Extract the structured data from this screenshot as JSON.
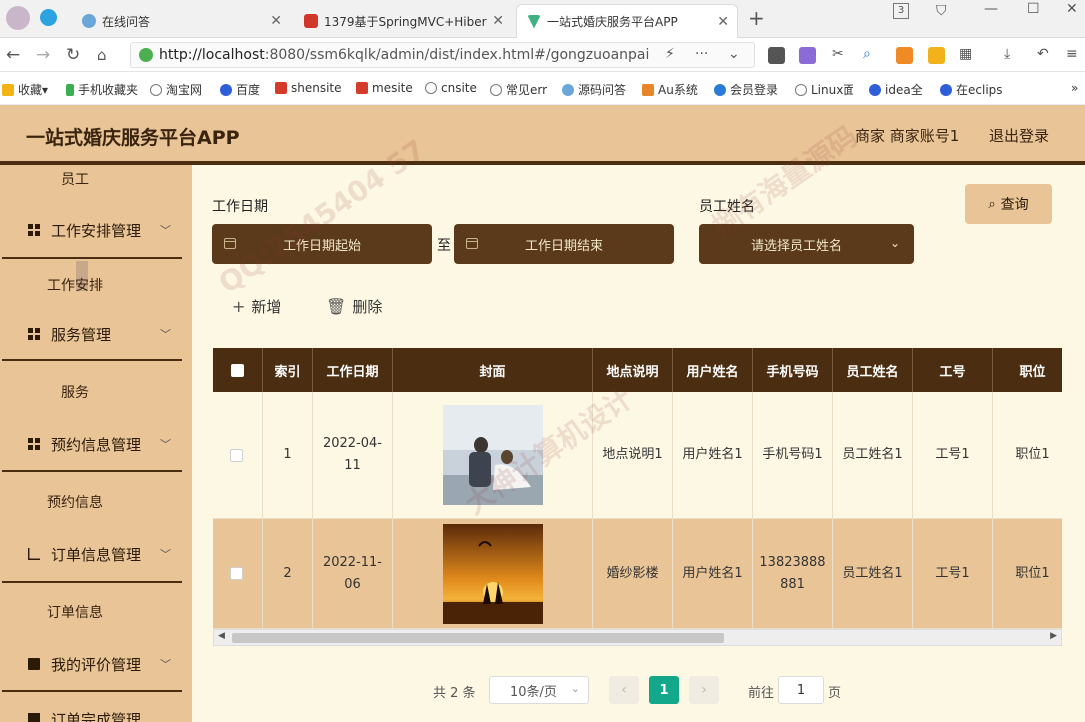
{
  "browser": {
    "tabs": [
      {
        "title": "在线问答",
        "active": false
      },
      {
        "title": "1379基于SpringMVC+Hiber",
        "active": false
      },
      {
        "title": "一站式婚庆服务平台APP",
        "active": true
      }
    ],
    "tab_count": "3",
    "url_host": "http://localhost",
    "url_rest": ":8080/ssm6kqlk/admin/dist/index.html#/gongzuoanpai",
    "bookmarks": [
      "收藏",
      "手机收藏夹",
      "淘宝网",
      "百度",
      "shensite",
      "mesite",
      "cnsite",
      "常见err",
      "源码问答",
      "Au系统",
      "会员登录",
      "Linux面",
      "idea全",
      "在eclips"
    ]
  },
  "app": {
    "title": "一站式婚庆服务平台APP",
    "user": "商家 商家账号1",
    "logout": "退出登录"
  },
  "sidebar": {
    "top_label": "员工",
    "menus": [
      {
        "label": "工作安排管理",
        "sub": "工作安排"
      },
      {
        "label": "服务管理",
        "sub": "服务"
      },
      {
        "label": "预约信息管理",
        "sub": "预约信息"
      },
      {
        "label": "订单信息管理",
        "sub": "订单信息"
      },
      {
        "label": "我的评价管理",
        "sub": ""
      },
      {
        "label": "订单完成管理",
        "sub": ""
      }
    ]
  },
  "search": {
    "date_label": "工作日期",
    "date_start_placeholder": "工作日期起始",
    "date_to": "至",
    "date_end_placeholder": "工作日期结束",
    "staff_label": "员工姓名",
    "staff_placeholder": "请选择员工姓名",
    "query_button": "查询"
  },
  "actions": {
    "add": "新增",
    "delete": "删除"
  },
  "table": {
    "columns": [
      "索引",
      "工作日期",
      "封面",
      "地点说明",
      "用户姓名",
      "手机号码",
      "员工姓名",
      "工号",
      "职位"
    ],
    "rows": [
      {
        "index": "1",
        "date": "2022-04-11",
        "location": "地点说明1",
        "user": "用户姓名1",
        "phone": "手机号码1",
        "staff": "员工姓名1",
        "staff_no": "工号1",
        "position": "职位1"
      },
      {
        "index": "2",
        "date": "2022-11-06",
        "location": "婚纱影楼",
        "user": "用户姓名1",
        "phone": "13823888881",
        "staff": "员工姓名1",
        "staff_no": "工号1",
        "position": "职位1"
      }
    ]
  },
  "pagination": {
    "total": "共 2 条",
    "page_size": "10条/页",
    "current": "1",
    "goto_label": "前往",
    "goto_value": "1",
    "page_suffix": "页"
  },
  "watermark": [
    "QQ:2545404 57",
    "捌有海量源码",
    "大神计算机设计"
  ],
  "colors": {
    "header": "#e8c497",
    "dark": "#4b2e12",
    "field": "#5a3a1a",
    "page_active": "#13a889"
  }
}
